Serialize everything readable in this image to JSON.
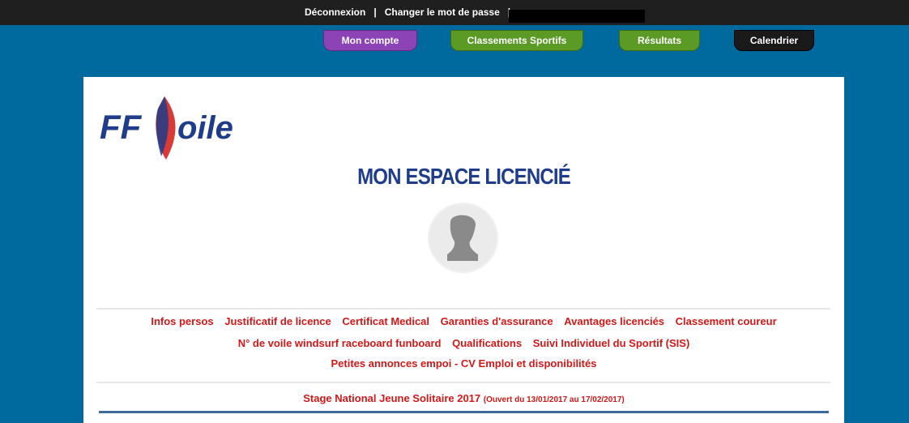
{
  "topbar": {
    "logout": "Déconnexion",
    "change_password": "Changer le mot de passe",
    "separator": "|"
  },
  "tabs": [
    {
      "label": "Mon compte",
      "color": "#8c43b5"
    },
    {
      "label": "Classements Sportifs",
      "color": "#5a9a25"
    },
    {
      "label": "Résultats",
      "color": "#5a9a25"
    },
    {
      "label": "Calendrier",
      "color": "#1a1a1a"
    }
  ],
  "logo": {
    "text_ff": "FF",
    "text_voile": "oile"
  },
  "page_title": "MON ESPACE LICENCIÉ",
  "menu": {
    "row1": [
      "Infos persos",
      "Justificatif de licence",
      "Certificat Medical",
      "Garanties d'assurance",
      "Avantages licenciés",
      "Classement coureur"
    ],
    "row2": [
      "N° de voile windsurf raceboard funboard",
      "Qualifications",
      "Suivi Individuel du Sportif (SIS)"
    ],
    "row3": [
      "Petites annonces empoi - CV Emploi et disponibilités"
    ]
  },
  "stage": {
    "title": "Stage National Jeune Solitaire 2017",
    "dates": "(Ouvert du 13/01/2017 au 17/02/2017)"
  },
  "colors": {
    "background": "#006a9e",
    "topbar": "#1f1f1f",
    "link_red": "#d11818",
    "title_blue": "#1f3d8a"
  }
}
